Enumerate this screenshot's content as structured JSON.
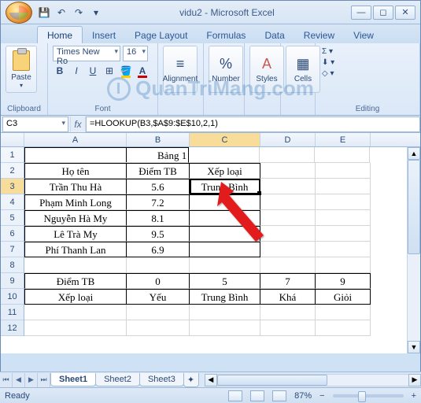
{
  "window": {
    "title": "vidu2 - Microsoft Excel"
  },
  "qat": {
    "save": "💾",
    "undo": "↶",
    "redo": "↷",
    "more": "▾"
  },
  "tabs": [
    "Home",
    "Insert",
    "Page Layout",
    "Formulas",
    "Data",
    "Review",
    "View"
  ],
  "active_tab": "Home",
  "ribbon": {
    "clipboard": {
      "paste": "Paste",
      "label": "Clipboard"
    },
    "font": {
      "name": "Times New Ro",
      "size": "16",
      "label": "Font"
    },
    "alignment": {
      "label": "Alignment"
    },
    "number": {
      "label": "Number"
    },
    "styles": {
      "label": "Styles"
    },
    "cells": {
      "label": "Cells"
    },
    "editing": {
      "label": "Editing"
    }
  },
  "namebox": "C3",
  "formula": "=HLOOKUP(B3,$A$9:$E$10,2,1)",
  "columns": [
    "A",
    "B",
    "C",
    "D",
    "E"
  ],
  "rows": [
    "1",
    "2",
    "3",
    "4",
    "5",
    "6",
    "7",
    "8",
    "9",
    "10",
    "11",
    "12"
  ],
  "table1": {
    "title": "Bảng 1",
    "headers": {
      "name": "Họ tên",
      "score": "Điểm TB",
      "rank": "Xếp loại"
    },
    "rows": [
      {
        "name": "Trần Thu Hà",
        "score": "5.6",
        "rank": "Trung Bình"
      },
      {
        "name": "Phạm Minh Long",
        "score": "7.2",
        "rank": ""
      },
      {
        "name": "Nguyễn Hà My",
        "score": "8.1",
        "rank": ""
      },
      {
        "name": "Lê Trà My",
        "score": "9.5",
        "rank": ""
      },
      {
        "name": "Phí Thanh Lan",
        "score": "6.9",
        "rank": ""
      }
    ]
  },
  "lookup": {
    "r1": {
      "label": "Điểm TB",
      "c1": "0",
      "c2": "5",
      "c3": "7",
      "c4": "9"
    },
    "r2": {
      "label": "Xếp loại",
      "c1": "Yếu",
      "c2": "Trung Bình",
      "c3": "Khá",
      "c4": "Giỏi"
    }
  },
  "sheets": [
    "Sheet1",
    "Sheet2",
    "Sheet3"
  ],
  "status": {
    "ready": "Ready",
    "zoom": "87%"
  },
  "watermark": "QuanTriMang.com"
}
